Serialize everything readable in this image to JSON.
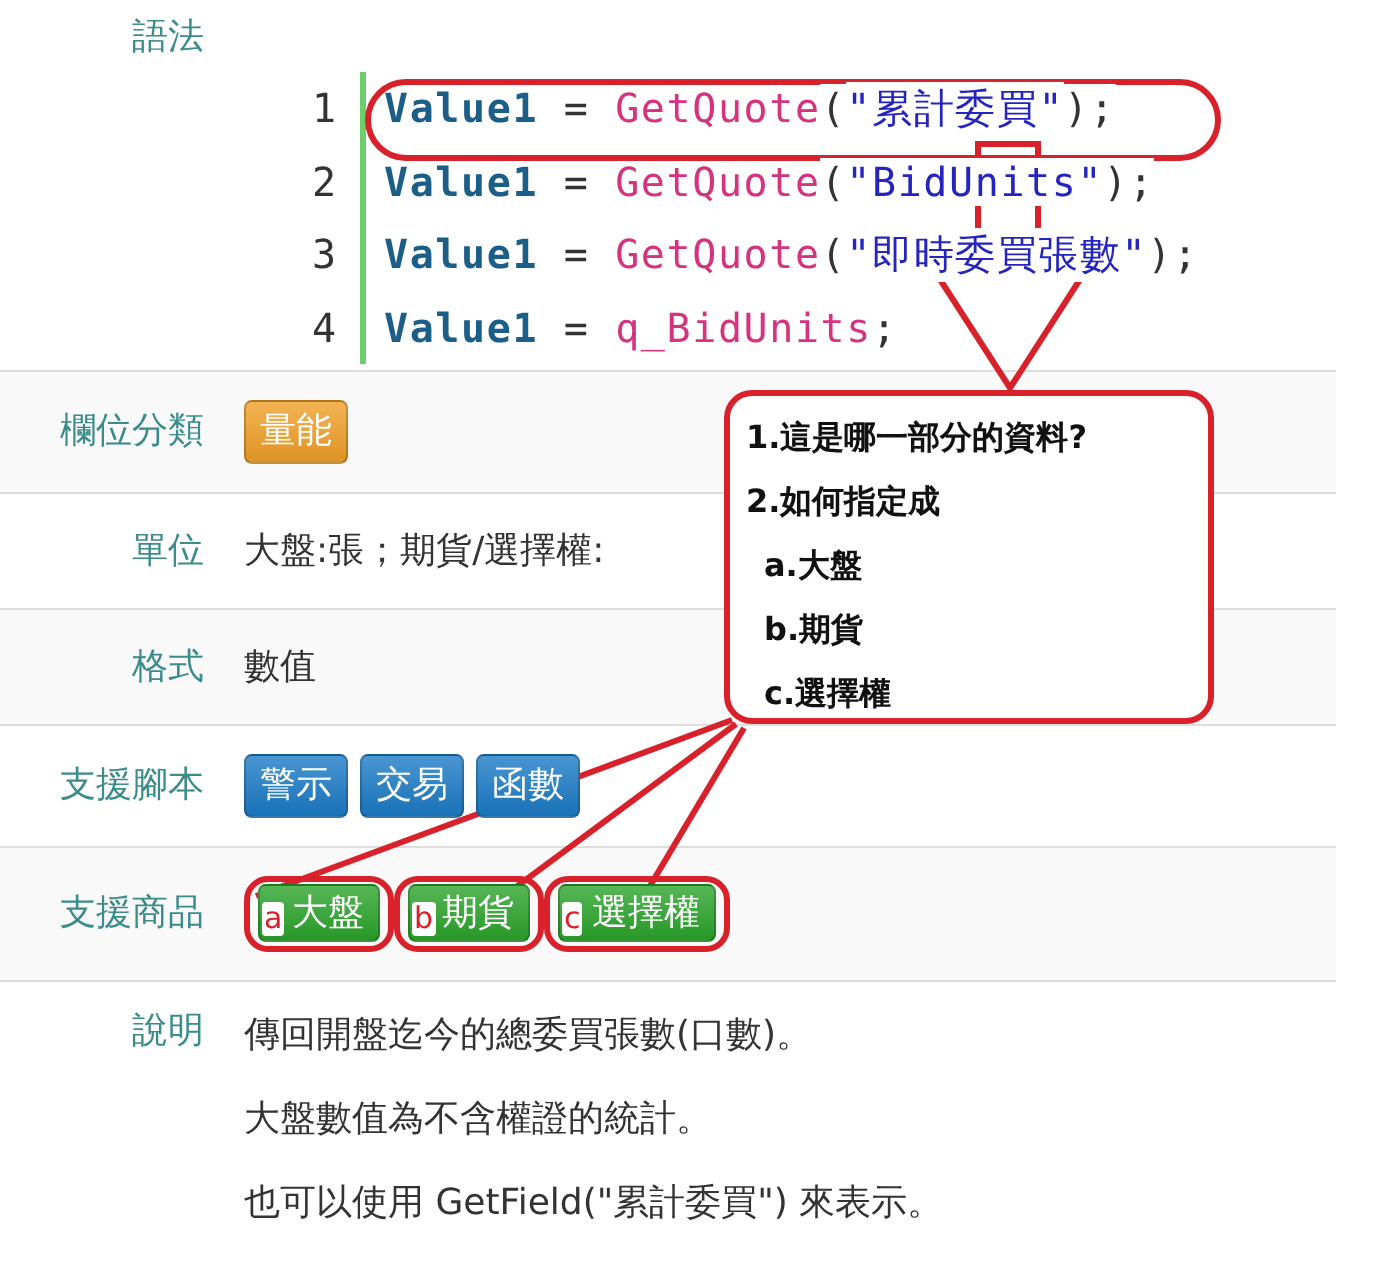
{
  "syntax": {
    "label": "語法",
    "lines": [
      {
        "number": "1",
        "tokens": [
          {
            "kind": "var",
            "text": "Value1"
          },
          {
            "kind": "op",
            "text": " = "
          },
          {
            "kind": "func",
            "text": "GetQuote"
          },
          {
            "kind": "punct",
            "text": "("
          },
          {
            "kind": "string",
            "text": "\"累計委買\""
          },
          {
            "kind": "punct",
            "text": ");"
          }
        ]
      },
      {
        "number": "2",
        "tokens": [
          {
            "kind": "var",
            "text": "Value1"
          },
          {
            "kind": "op",
            "text": " = "
          },
          {
            "kind": "func",
            "text": "GetQuote"
          },
          {
            "kind": "punct",
            "text": "("
          },
          {
            "kind": "string",
            "text": "\"BidUnits\""
          },
          {
            "kind": "punct",
            "text": ");"
          }
        ]
      },
      {
        "number": "3",
        "tokens": [
          {
            "kind": "var",
            "text": "Value1"
          },
          {
            "kind": "op",
            "text": " = "
          },
          {
            "kind": "func",
            "text": "GetQuote"
          },
          {
            "kind": "punct",
            "text": "("
          },
          {
            "kind": "string",
            "text": "\"即時委買張數\""
          },
          {
            "kind": "punct",
            "text": ");"
          }
        ]
      },
      {
        "number": "4",
        "tokens": [
          {
            "kind": "var",
            "text": "Value1"
          },
          {
            "kind": "op",
            "text": " = "
          },
          {
            "kind": "func",
            "text": "q_BidUnits"
          },
          {
            "kind": "punct",
            "text": ";"
          }
        ]
      }
    ]
  },
  "fields": [
    {
      "label": "欄位分類",
      "kind": "badges",
      "badges": [
        {
          "text": "量能",
          "color": "#f0a028"
        }
      ]
    },
    {
      "label": "單位",
      "kind": "text",
      "text": "大盤:張；期貨/選擇權:"
    },
    {
      "label": "格式",
      "kind": "text",
      "text": "數值"
    },
    {
      "label": "支援腳本",
      "kind": "badges",
      "badges": [
        {
          "text": "警示",
          "color": "#1b7bc6"
        },
        {
          "text": "交易",
          "color": "#1b7bc6"
        },
        {
          "text": "函數",
          "color": "#1b7bc6"
        }
      ]
    },
    {
      "label": "支援商品",
      "kind": "badges",
      "badges": [
        {
          "text": "大盤",
          "color": "#2ba42b",
          "marker": "a"
        },
        {
          "text": "期貨",
          "color": "#2ba42b",
          "marker": "b"
        },
        {
          "text": "選擇權",
          "color": "#2ba42b",
          "marker": "c"
        }
      ]
    },
    {
      "label": "說明",
      "kind": "paragraphs",
      "paragraphs": [
        "傳回開盤迄今的總委買張數(口數)。",
        "大盤數值為不含權證的統計。",
        "也可以使用 GetField(\"累計委買\") 來表示。"
      ]
    }
  ],
  "callout": {
    "items": [
      {
        "kind": "question",
        "text": "1.這是哪一部分的資料?"
      },
      {
        "kind": "question",
        "text": "2.如何指定成"
      },
      {
        "kind": "option",
        "text": "a.大盤"
      },
      {
        "kind": "option",
        "text": "b.期貨"
      },
      {
        "kind": "option",
        "text": "c.選擇權"
      }
    ]
  }
}
